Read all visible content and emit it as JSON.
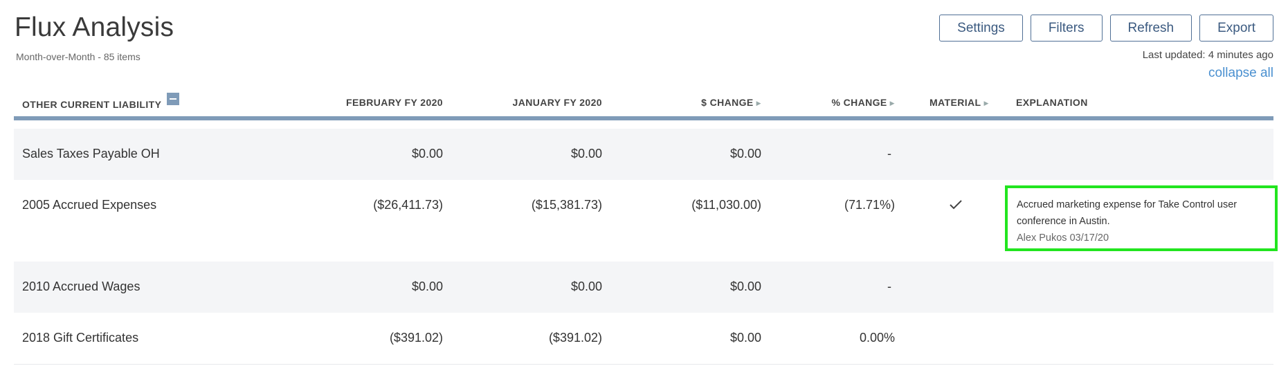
{
  "header": {
    "title": "Flux Analysis",
    "subtitle": "Month-over-Month - 85 items",
    "last_updated": "Last updated: 4 minutes ago",
    "collapse_all": "collapse all"
  },
  "toolbar": {
    "settings": "Settings",
    "filters": "Filters",
    "refresh": "Refresh",
    "export": "Export"
  },
  "columns": {
    "account": "OTHER CURRENT LIABILITY",
    "feb": "FEBRUARY FY 2020",
    "jan": "JANUARY FY 2020",
    "dollar_change": "$ CHANGE",
    "pct_change": "% CHANGE",
    "material": "MATERIAL",
    "explanation": "EXPLANATION"
  },
  "rows": [
    {
      "account": "Sales Taxes Payable OH",
      "feb": "$0.00",
      "jan": "$0.00",
      "dollar_change": "$0.00",
      "pct_change": "-",
      "material": false
    },
    {
      "account": "2005 Accrued Expenses",
      "feb": "($26,411.73)",
      "jan": "($15,381.73)",
      "dollar_change": "($11,030.00)",
      "pct_change": "(71.71%)",
      "material": true,
      "explanation": {
        "text": "Accrued marketing expense for Take Control user conference in Austin.",
        "author": "Alex Pukos 03/17/20"
      }
    },
    {
      "account": "2010 Accrued Wages",
      "feb": "$0.00",
      "jan": "$0.00",
      "dollar_change": "$0.00",
      "pct_change": "-",
      "material": false
    },
    {
      "account": "2018 Gift Certificates",
      "feb": "($391.02)",
      "jan": "($391.02)",
      "dollar_change": "$0.00",
      "pct_change": "0.00%",
      "material": false
    }
  ],
  "colors": {
    "accent": "#4a90d0",
    "button_border": "#4f6f95",
    "header_rule": "#7f9bb8",
    "highlight": "#22e51f"
  },
  "icons": {
    "collapse": "minus-square-icon",
    "sort": "caret-right-icon",
    "material": "checkmark-icon"
  }
}
